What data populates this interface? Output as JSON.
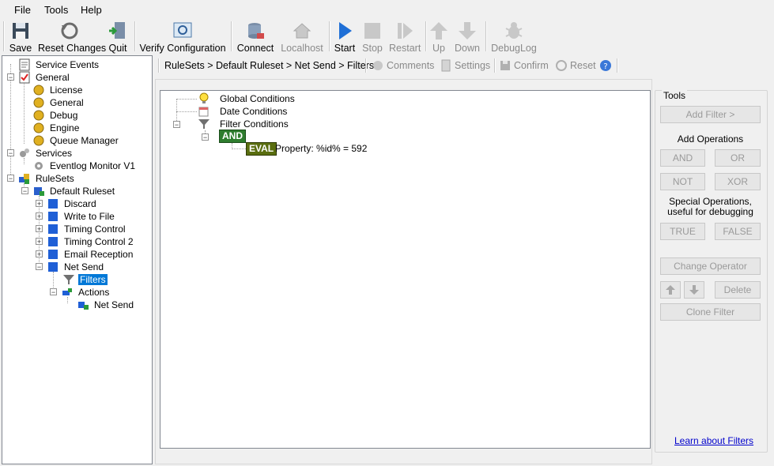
{
  "menu": {
    "items": [
      "File",
      "Tools",
      "Help"
    ]
  },
  "toolbar": {
    "save": "Save",
    "reset_changes": "Reset Changes",
    "quit": "Quit",
    "verify": "Verify Configuration",
    "connect": "Connect",
    "localhost": "Localhost",
    "start": "Start",
    "stop": "Stop",
    "restart": "Restart",
    "up": "Up",
    "down": "Down",
    "debuglog": "DebugLog"
  },
  "tree": {
    "service_events": "Service Events",
    "general": "General",
    "license": "License",
    "general_sub": "General",
    "debug": "Debug",
    "engine": "Engine",
    "queue_manager": "Queue Manager",
    "services": "Services",
    "eventlog_monitor": "Eventlog Monitor V1",
    "rulesets": "RuleSets",
    "default_ruleset": "Default Ruleset",
    "discard": "Discard",
    "write_to_file": "Write to File",
    "timing_control": "Timing Control",
    "timing_control_2": "Timing Control 2",
    "email_reception": "Email Reception",
    "net_send": "Net Send",
    "filters": "Filters",
    "actions": "Actions",
    "net_send_action": "Net Send"
  },
  "breadcrumb": {
    "path": "RuleSets > Default Ruleset > Net Send > Filters",
    "comments": "Comments",
    "settings": "Settings",
    "confirm": "Confirm",
    "reset": "Reset"
  },
  "filters": {
    "global_conditions": "Global Conditions",
    "date_conditions": "Date Conditions",
    "filter_conditions": "Filter Conditions",
    "and_badge": "AND",
    "eval_badge": "EVAL",
    "eval_text": "Property: %id% = 592"
  },
  "tools": {
    "title": "Tools",
    "add_filter": "Add Filter >",
    "add_operations": "Add Operations",
    "and": "AND",
    "or": "OR",
    "not": "NOT",
    "xor": "XOR",
    "special_line1": "Special Operations,",
    "special_line2": "useful for debugging",
    "true": "TRUE",
    "false": "FALSE",
    "change_operator": "Change Operator",
    "delete": "Delete",
    "clone_filter": "Clone Filter",
    "learn_link": "Learn about Filters"
  },
  "colors": {
    "selection": "#0078d7",
    "and_badge": "#2e7d2e",
    "eval_badge": "#5a6e10",
    "link": "#0000cc"
  }
}
